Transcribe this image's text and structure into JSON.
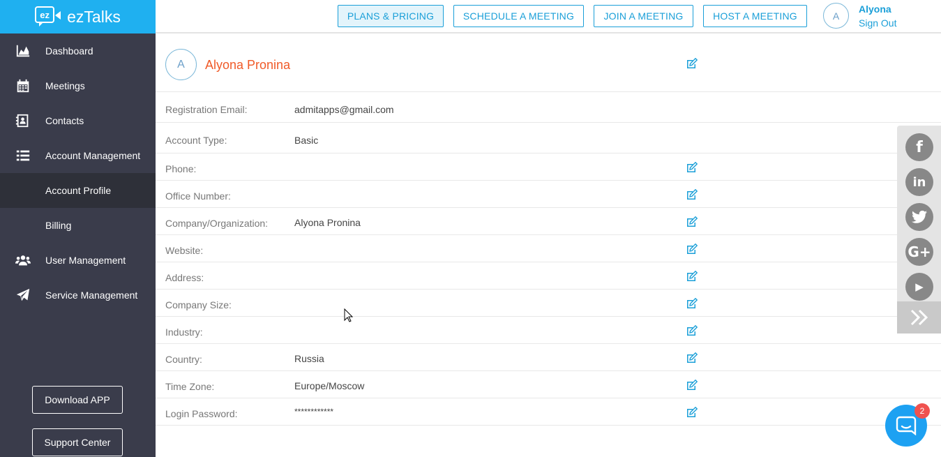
{
  "brand": {
    "name": "ezTalks",
    "badge": "ez"
  },
  "sidebar": {
    "items": [
      {
        "label": "Dashboard",
        "icon": "area-chart-icon"
      },
      {
        "label": "Meetings",
        "icon": "calendar-icon"
      },
      {
        "label": "Contacts",
        "icon": "address-book-icon"
      },
      {
        "label": "Account Management",
        "icon": "list-icon"
      },
      {
        "label": "Account Profile",
        "icon": ""
      },
      {
        "label": "Billing",
        "icon": ""
      },
      {
        "label": "User Management",
        "icon": "users-icon"
      },
      {
        "label": "Service Management",
        "icon": "paper-plane-icon"
      }
    ],
    "download_label": "Download APP",
    "support_label": "Support Center"
  },
  "header": {
    "plans_label": "PLANS & PRICING",
    "schedule_label": "SCHEDULE A MEETING",
    "join_label": "JOIN A MEETING",
    "host_label": "HOST A MEETING",
    "avatar_initial": "A",
    "user_name": "Alyona",
    "signout_label": "Sign Out"
  },
  "profile": {
    "avatar_initial": "A",
    "full_name": "Alyona Pronina",
    "fields": [
      {
        "label": "Registration Email:",
        "value": "admitapps@gmail.com"
      },
      {
        "label": "Account Type:",
        "value": "Basic"
      },
      {
        "label": "Phone:",
        "value": ""
      },
      {
        "label": "Office Number:",
        "value": ""
      },
      {
        "label": "Company/Organization:",
        "value": "Alyona Pronina"
      },
      {
        "label": "Website:",
        "value": ""
      },
      {
        "label": "Address:",
        "value": ""
      },
      {
        "label": "Company Size:",
        "value": ""
      },
      {
        "label": "Industry:",
        "value": ""
      },
      {
        "label": "Country:",
        "value": "Russia"
      },
      {
        "label": "Time Zone:",
        "value": "Europe/Moscow"
      },
      {
        "label": "Login Password:",
        "value": "************"
      }
    ]
  },
  "social": {
    "facebook_glyph": "f",
    "linkedin_glyph": "in",
    "twitter_glyph": "t",
    "googleplus_glyph": "G+",
    "video_glyph": "▶"
  },
  "chat": {
    "badge_count": "2"
  },
  "colors": {
    "brand_blue": "#1fb0f0",
    "sidebar_bg": "#3a3c4b",
    "accent_orange": "#f05a28",
    "link_blue": "#1a9fd8"
  }
}
